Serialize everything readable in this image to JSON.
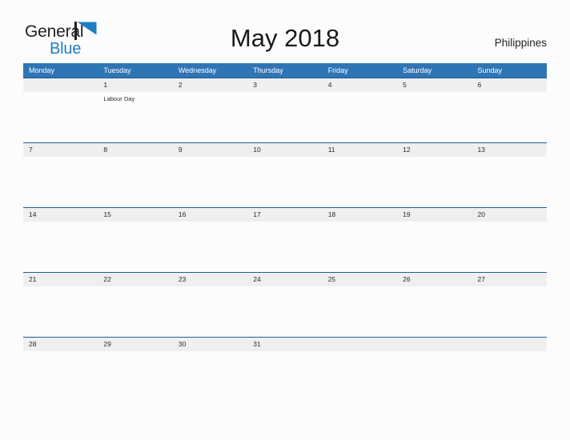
{
  "brand": {
    "name_part1": "General",
    "name_part2": "Blue",
    "flag_icon": "blue-flag-triangle-icon",
    "color_dark": "#231f20",
    "color_blue": "#1f7ec4"
  },
  "header": {
    "title": "May 2018",
    "country": "Philippines"
  },
  "theme": {
    "header_blue": "#2e75b6",
    "row_divider_blue": "#1f5c99",
    "date_band_gray": "#efeff0",
    "page_background": "#fcfcfd",
    "text_dark": "#2a2a2a",
    "header_text": "#ffffff"
  },
  "calendar": {
    "weekdays": [
      "Monday",
      "Tuesday",
      "Wednesday",
      "Thursday",
      "Friday",
      "Saturday",
      "Sunday"
    ],
    "weeks": [
      {
        "days": [
          {
            "date": "",
            "event": ""
          },
          {
            "date": "1",
            "event": "Labour Day"
          },
          {
            "date": "2",
            "event": ""
          },
          {
            "date": "3",
            "event": ""
          },
          {
            "date": "4",
            "event": ""
          },
          {
            "date": "5",
            "event": ""
          },
          {
            "date": "6",
            "event": ""
          }
        ]
      },
      {
        "days": [
          {
            "date": "7",
            "event": ""
          },
          {
            "date": "8",
            "event": ""
          },
          {
            "date": "9",
            "event": ""
          },
          {
            "date": "10",
            "event": ""
          },
          {
            "date": "11",
            "event": ""
          },
          {
            "date": "12",
            "event": ""
          },
          {
            "date": "13",
            "event": ""
          }
        ]
      },
      {
        "days": [
          {
            "date": "14",
            "event": ""
          },
          {
            "date": "15",
            "event": ""
          },
          {
            "date": "16",
            "event": ""
          },
          {
            "date": "17",
            "event": ""
          },
          {
            "date": "18",
            "event": ""
          },
          {
            "date": "19",
            "event": ""
          },
          {
            "date": "20",
            "event": ""
          }
        ]
      },
      {
        "days": [
          {
            "date": "21",
            "event": ""
          },
          {
            "date": "22",
            "event": ""
          },
          {
            "date": "23",
            "event": ""
          },
          {
            "date": "24",
            "event": ""
          },
          {
            "date": "25",
            "event": ""
          },
          {
            "date": "26",
            "event": ""
          },
          {
            "date": "27",
            "event": ""
          }
        ]
      },
      {
        "days": [
          {
            "date": "28",
            "event": ""
          },
          {
            "date": "29",
            "event": ""
          },
          {
            "date": "30",
            "event": ""
          },
          {
            "date": "31",
            "event": ""
          },
          {
            "date": "",
            "event": ""
          },
          {
            "date": "",
            "event": ""
          },
          {
            "date": "",
            "event": ""
          }
        ]
      }
    ]
  }
}
